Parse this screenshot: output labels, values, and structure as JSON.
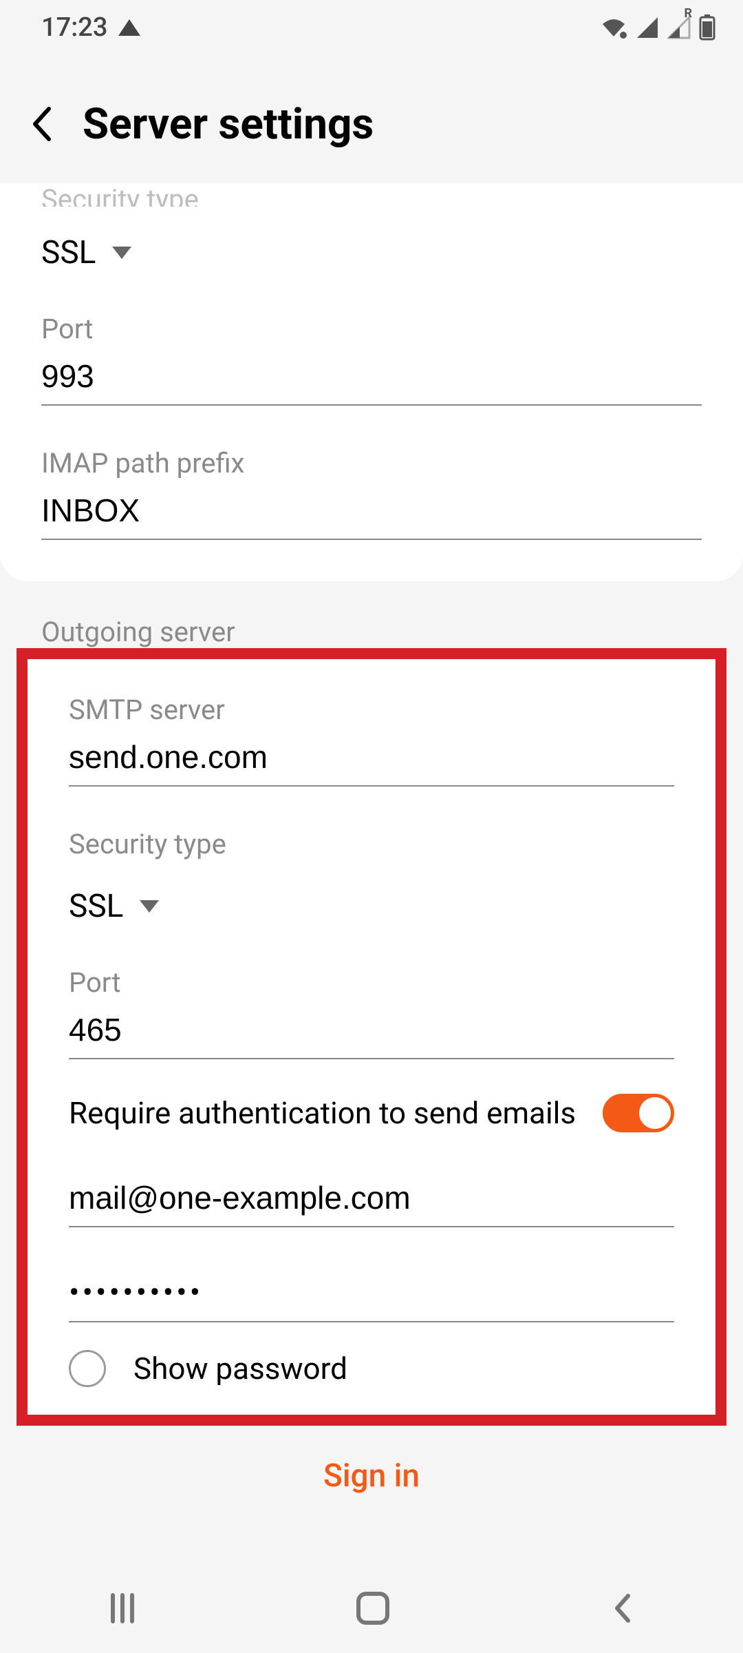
{
  "status": {
    "time": "17:23",
    "roaming_label": "R"
  },
  "header": {
    "title": "Server settings"
  },
  "incoming": {
    "security_label": "Security type",
    "security_value": "SSL",
    "port_label": "Port",
    "port_value": "993",
    "imap_prefix_label": "IMAP path prefix",
    "imap_prefix_value": "INBOX"
  },
  "outgoing_header": "Outgoing server",
  "outgoing": {
    "smtp_label": "SMTP server",
    "smtp_value": "send.one.com",
    "security_label": "Security type",
    "security_value": "SSL",
    "port_label": "Port",
    "port_value": "465",
    "require_auth_label": "Require authentication to send emails",
    "require_auth_on": true,
    "email_value": "mail@one-example.com",
    "password_mask": "••••••••••",
    "show_password_label": "Show password",
    "show_password_checked": false
  },
  "signin_label": "Sign in",
  "colors": {
    "accent": "#f35a16",
    "highlight_border": "#d52027"
  }
}
